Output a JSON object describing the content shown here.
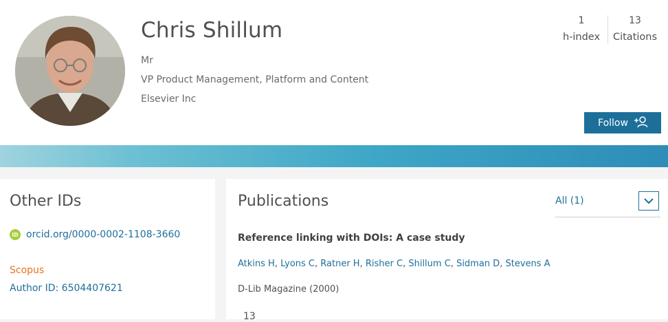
{
  "profile": {
    "name": "Chris Shillum",
    "salutation": "Mr",
    "position": "VP Product Management, Platform and Content",
    "organization": "Elsevier Inc"
  },
  "metrics": [
    {
      "value": "1",
      "label": "h-index"
    },
    {
      "value": "13",
      "label": "Citations"
    }
  ],
  "follow": {
    "label": "Follow",
    "icon": "add-person-icon"
  },
  "other_ids": {
    "title": "Other IDs",
    "orcid": {
      "icon": "orcid-icon",
      "badge_text": "iD",
      "link": "orcid.org/0000-0002-1108-3660"
    },
    "scopus_label": "Scopus",
    "author_id": "Author ID: 6504407621"
  },
  "publications": {
    "title": "Publications",
    "filter_label": "All (1)",
    "items": [
      {
        "title": "Reference linking with DOIs: A case study",
        "authors": [
          "Atkins H",
          "Lyons C",
          "Ratner H",
          "Risher C",
          "Shillum C",
          "Sidman D",
          "Stevens A"
        ],
        "journal": "D-Lib Magazine (2000)",
        "citations": "13"
      }
    ]
  },
  "colors": {
    "accent": "#1d6f9a",
    "scopus": "#e9711c",
    "orcid": "#a6ce39",
    "banner_start": "#9fd3df",
    "banner_end": "#2d8db8"
  }
}
